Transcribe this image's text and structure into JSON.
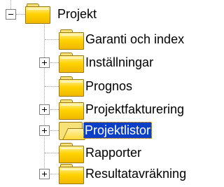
{
  "tree": {
    "root": {
      "label": "Projekt",
      "icon": "folder-icon",
      "expanded": true
    },
    "children": [
      {
        "label": "Garanti och index",
        "icon": "folder-icon",
        "has_children": false
      },
      {
        "label": "Inställningar",
        "icon": "folder-icon",
        "has_children": true
      },
      {
        "label": "Prognos",
        "icon": "folder-icon",
        "has_children": false
      },
      {
        "label": "Projektfakturering",
        "icon": "folder-icon",
        "has_children": true
      },
      {
        "label": "Projektlistor",
        "icon": "folder-open-icon",
        "has_children": true,
        "selected": true
      },
      {
        "label": "Rapporter",
        "icon": "folder-icon",
        "has_children": false
      },
      {
        "label": "Resultatavräkning",
        "icon": "folder-icon",
        "has_children": true
      }
    ]
  },
  "colors": {
    "selection_background": "#0a3fc6",
    "selection_text": "#ffffff",
    "folder": "#ffd200",
    "connector": "#a0a0a0"
  }
}
